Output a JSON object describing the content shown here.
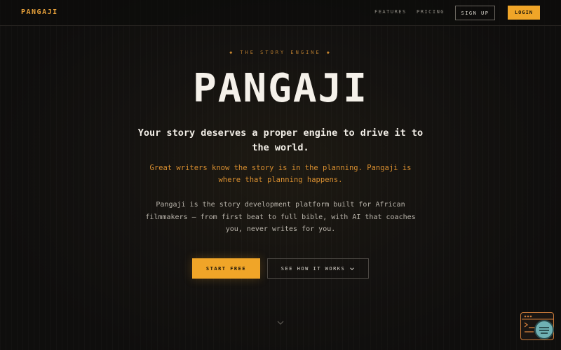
{
  "nav": {
    "logo": "PANGAJI",
    "links": [
      "FEATURES",
      "PRICING"
    ],
    "signup_label": "SIGN UP",
    "login_label": "LOGIN"
  },
  "hero": {
    "eyebrow_text": "THE STORY ENGINE",
    "eyebrow_glyph": "◆",
    "title": "PANGAJI",
    "tagline": "Your story deserves a proper engine to drive it to the world.",
    "sub_accent": "Great writers know the story is in the planning. Pangaji is where that planning happens.",
    "sub_body": "Pangaji is the story development platform built for African filmmakers — from first beat to full bible, with AI that coaches you, never writes for you."
  },
  "cta": {
    "start_label": "START FREE",
    "how_label": "SEE HOW IT WORKS"
  },
  "icons": {
    "scroll": "chevron-down-icon",
    "widget": "assistant-widget-icon"
  },
  "colors": {
    "accent": "#f0a528",
    "background": "#141210",
    "accent_text": "#d98f30"
  }
}
